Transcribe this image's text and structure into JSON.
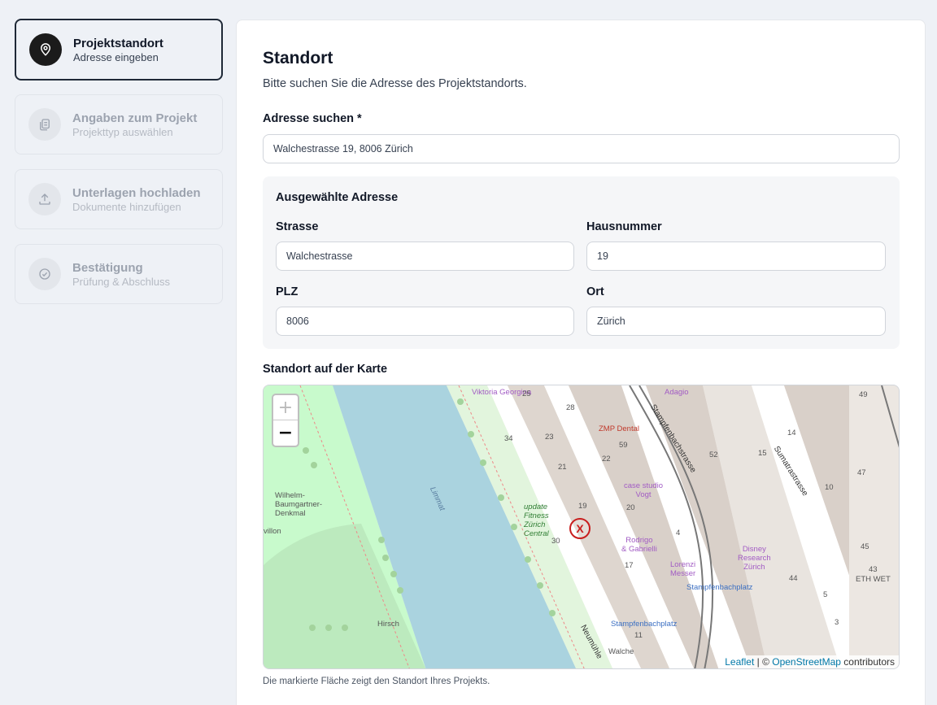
{
  "steps": [
    {
      "title": "Projektstandort",
      "subtitle": "Adresse eingeben",
      "icon": "location-pin-icon",
      "active": true
    },
    {
      "title": "Angaben zum Projekt",
      "subtitle": "Projekttyp auswählen",
      "icon": "document-copy-icon",
      "active": false
    },
    {
      "title": "Unterlagen hochladen",
      "subtitle": "Dokumente hinzufügen",
      "icon": "upload-icon",
      "active": false
    },
    {
      "title": "Bestätigung",
      "subtitle": "Prüfung & Abschluss",
      "icon": "check-circle-icon",
      "active": false
    }
  ],
  "main": {
    "title": "Standort",
    "lead": "Bitte suchen Sie die Adresse des Projektstandorts.",
    "search_label": "Adresse suchen *",
    "search_value": "Walchestrasse 19, 8006 Zürich",
    "selected": {
      "title": "Ausgewählte Adresse",
      "street_label": "Strasse",
      "street_value": "Walchestrasse",
      "number_label": "Hausnummer",
      "number_value": "19",
      "zip_label": "PLZ",
      "zip_value": "8006",
      "city_label": "Ort",
      "city_value": "Zürich"
    },
    "map_label": "Standort auf der Karte",
    "caption": "Die markierte Fläche zeigt den Standort Ihres Projekts."
  },
  "map": {
    "zoom_in": "+",
    "zoom_out": "−",
    "marker": "X",
    "attribution": {
      "leaflet": "Leaflet",
      "sep": " | © ",
      "osm": "OpenStreetMap",
      "rest": " contributors"
    },
    "labels": {
      "viktoria": "Viktoria Georgina",
      "adagio": "Adagio",
      "zmp": "ZMP Dental",
      "stampfen": "Stampfenbachstrasse",
      "sumatra": "Sumatrastrasse",
      "limmat": "Limmat",
      "wilhelm": "Wilhelm-",
      "baumgartner": "Baumgartner-",
      "denkmal": "Denkmal",
      "villon": "villon",
      "hirsch": "Hirsch",
      "update1": "update",
      "update2": "Fitness",
      "update3": "Zürich",
      "update4": "Central",
      "casestudio1": "case studio",
      "casestudio2": "Vogt",
      "rodrigo1": "Rodrigo",
      "rodrigo2": "& Gabrielli",
      "lorenzi1": "Lorenzi",
      "lorenzi2": "Messer",
      "disney1": "Disney",
      "disney2": "Research",
      "disney3": "Zürich",
      "stplatz1": "Stampfenbachplatz",
      "stplatz2": "Stampfenbachplatz",
      "walche": "Walche",
      "neumuehle": "Neumühle",
      "ethwet": "ETH WET",
      "n25": "25",
      "n28": "28",
      "n34": "34",
      "n23": "23",
      "n21": "21",
      "n22": "22",
      "n59": "59",
      "n52": "52",
      "n15": "15",
      "n14": "14",
      "n49": "49",
      "n47": "47",
      "n10": "10",
      "n19": "19",
      "n20": "20",
      "n4": "4",
      "n30": "30",
      "n17": "17",
      "n45": "45",
      "n43": "43",
      "n44": "44",
      "n5": "5",
      "n3": "3",
      "n11": "11"
    }
  }
}
